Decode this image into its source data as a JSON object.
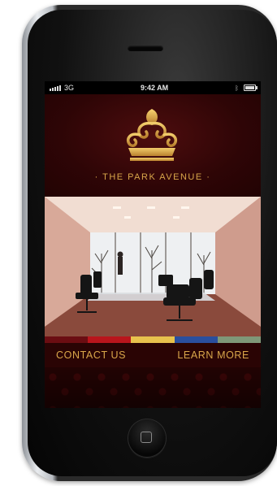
{
  "status_bar": {
    "carrier": "3G",
    "time": "9:42 AM",
    "icons": [
      "signal-icon",
      "bluetooth-icon",
      "battery-icon"
    ]
  },
  "header": {
    "brand_name": "THE PARK AVENUE",
    "logo_icon": "crown-fleur-icon",
    "accent_color": "#d9a64a"
  },
  "color_bar": {
    "colors": [
      "#6b0d12",
      "#b9151c",
      "#e8c24d",
      "#2a4f9e",
      "#7f9878"
    ]
  },
  "nav": {
    "contact_label": "CONTACT US",
    "learn_label": "LEARN MORE"
  },
  "device": {
    "home_button_icon": "home-button-icon"
  }
}
